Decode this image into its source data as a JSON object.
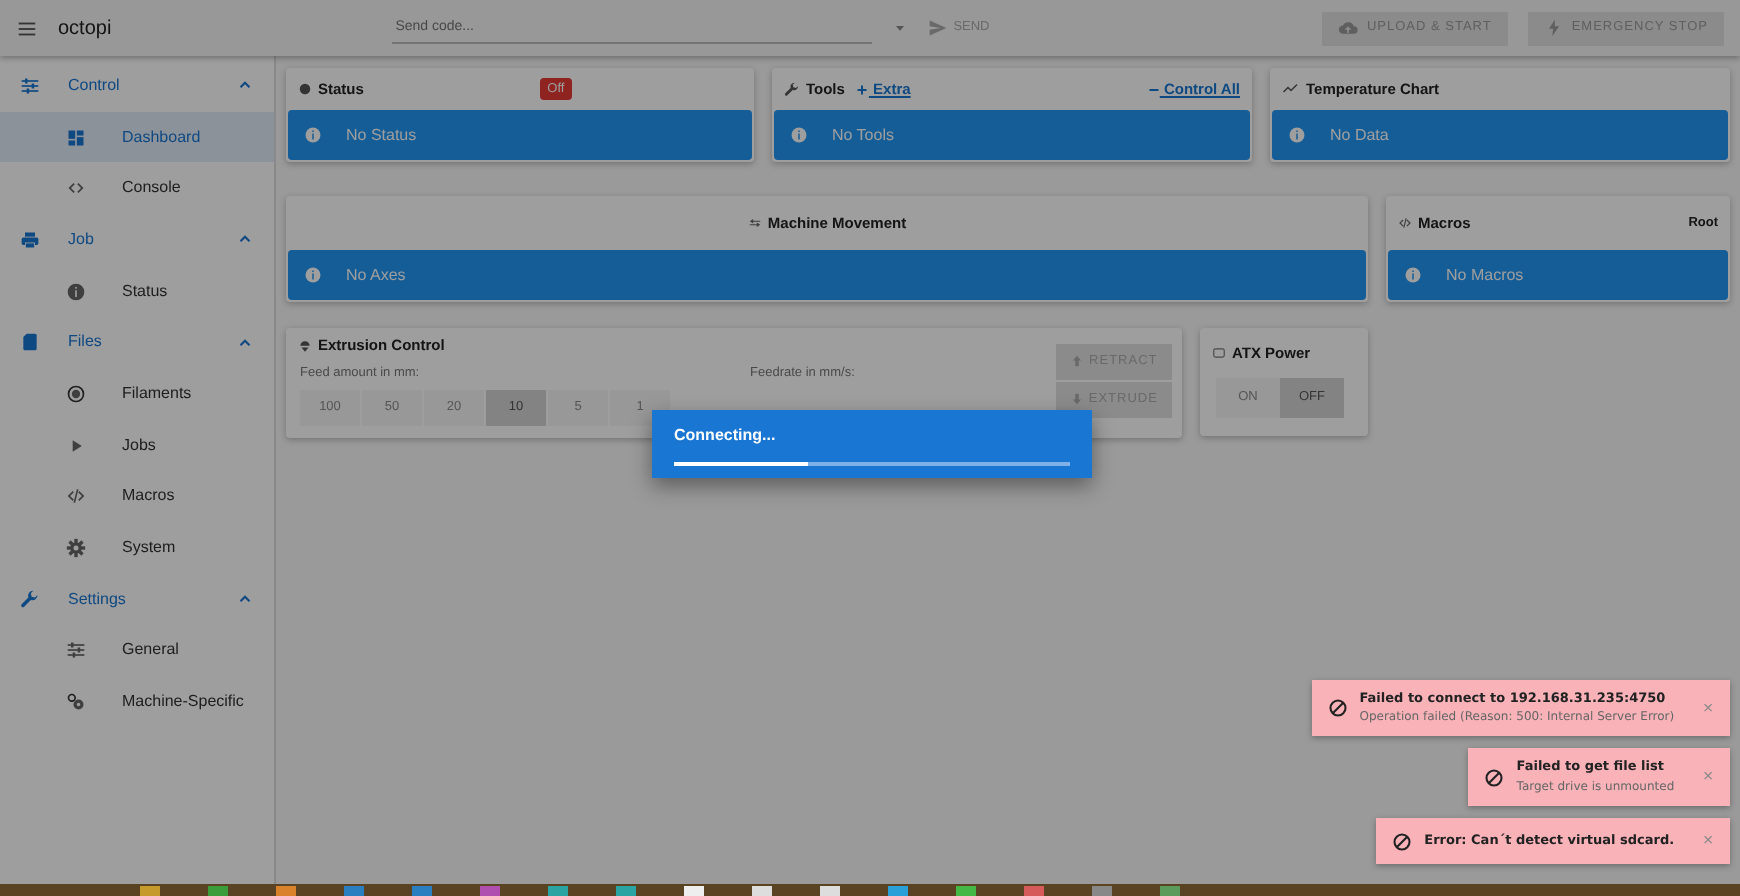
{
  "app_bar": {
    "title": "octopi",
    "code_placeholder": "Send code...",
    "send": "SEND",
    "buttons": [
      {
        "label": "UPLOAD & START",
        "kind": "upload",
        "disabled": true
      },
      {
        "label": "EMERGENCY STOP",
        "kind": "stop",
        "disabled": true
      }
    ]
  },
  "sidebar": [
    {
      "label": "Control",
      "kind": "control",
      "expanded": true,
      "children": [
        {
          "label": "Dashboard",
          "kind": "dashboard",
          "selected": true
        },
        {
          "label": "Console",
          "kind": "console",
          "selected": false
        }
      ]
    },
    {
      "label": "Job",
      "kind": "printer",
      "expanded": true,
      "children": [
        {
          "label": "Status",
          "kind": "info",
          "selected": false
        }
      ]
    },
    {
      "label": "Files",
      "kind": "file",
      "expanded": true,
      "children": [
        {
          "label": "Filaments",
          "kind": "radio",
          "selected": false
        },
        {
          "label": "Jobs",
          "kind": "play",
          "selected": false
        },
        {
          "label": "Macros",
          "kind": "code",
          "selected": false
        },
        {
          "label": "System",
          "kind": "gear",
          "selected": false
        }
      ]
    },
    {
      "label": "Settings",
      "kind": "wrench",
      "expanded": true,
      "children": [
        {
          "label": "General",
          "kind": "sliders",
          "selected": false
        },
        {
          "label": "Machine-Specific",
          "kind": "gears",
          "selected": false
        }
      ]
    }
  ],
  "status_card": {
    "title": "Status",
    "badge": "Off",
    "alert": "No Status"
  },
  "tools_card": {
    "title": "Tools",
    "links": [
      "Extra",
      "Control All"
    ],
    "alert": "No Tools"
  },
  "temperature_card": {
    "title": "Temperature Chart",
    "alert": "No Data"
  },
  "movement_card": {
    "title": "Machine Movement",
    "alert": "No Axes"
  },
  "macros_card": {
    "title": "Macros",
    "path": "Root",
    "alert": "No Macros"
  },
  "extrusion_card": {
    "title": "Extrusion Control",
    "feed_label": "Feed amount in mm:",
    "amounts": [
      {
        "label": "100",
        "selected": false
      },
      {
        "label": "50",
        "selected": false
      },
      {
        "label": "20",
        "selected": false
      },
      {
        "label": "10",
        "selected": true
      },
      {
        "label": "5",
        "selected": false
      },
      {
        "label": "1",
        "selected": false
      }
    ],
    "feedrate_label": "Feedrate in mm/s:",
    "buttons": [
      {
        "label": "RETRACT",
        "kind": "up"
      },
      {
        "label": "EXTRUDE",
        "kind": "down"
      }
    ]
  },
  "atx_card": {
    "title": "ATX Power",
    "buttons": [
      {
        "label": "ON",
        "selected": false
      },
      {
        "label": "OFF",
        "selected": true
      }
    ]
  },
  "dialog": {
    "title": "Connecting...",
    "level": 0.34
  },
  "notifications": [
    {
      "title": "Failed to connect to 192.168.31.235:4750",
      "message": "Operation failed (Reason: 500: Internal Server Error)",
      "close": "×"
    },
    {
      "title": "Failed to get file list",
      "message": "Target drive is unmounted",
      "close": "×"
    },
    {
      "title": "Error: Can´t detect virtual sdcard.",
      "close": "×"
    }
  ]
}
